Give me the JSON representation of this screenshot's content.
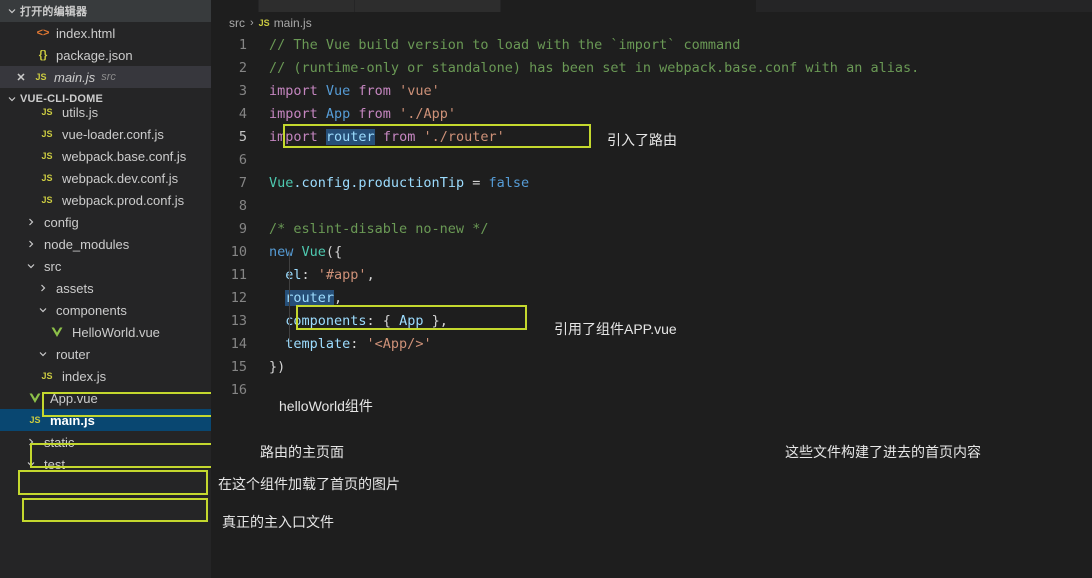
{
  "sidebar": {
    "open_editors_header": "打开的编辑器",
    "project_header": "VUE-CLI-DOME",
    "open_editors": [
      {
        "label": "index.html",
        "icon": "html-icon",
        "suffix": "",
        "closable": false
      },
      {
        "label": "package.json",
        "icon": "json-icon",
        "suffix": "",
        "closable": false
      },
      {
        "label": "main.js",
        "icon": "js-icon",
        "suffix": "src",
        "closable": true
      }
    ],
    "tree": [
      {
        "label": "utils.js",
        "icon": "js-icon",
        "indent": 2,
        "kind": "file",
        "clipped": true
      },
      {
        "label": "vue-loader.conf.js",
        "icon": "js-icon",
        "indent": 2,
        "kind": "file"
      },
      {
        "label": "webpack.base.conf.js",
        "icon": "js-icon",
        "indent": 2,
        "kind": "file"
      },
      {
        "label": "webpack.dev.conf.js",
        "icon": "js-icon",
        "indent": 2,
        "kind": "file"
      },
      {
        "label": "webpack.prod.conf.js",
        "icon": "js-icon",
        "indent": 2,
        "kind": "file"
      },
      {
        "label": "config",
        "icon": "chevron-right-icon",
        "indent": 1,
        "kind": "folder-collapsed"
      },
      {
        "label": "node_modules",
        "icon": "chevron-right-icon",
        "indent": 1,
        "kind": "folder-collapsed"
      },
      {
        "label": "src",
        "icon": "chevron-down-icon",
        "indent": 1,
        "kind": "folder-expanded"
      },
      {
        "label": "assets",
        "icon": "chevron-right-icon",
        "indent": 2,
        "kind": "folder-collapsed"
      },
      {
        "label": "components",
        "icon": "chevron-down-icon",
        "indent": 2,
        "kind": "folder-expanded"
      },
      {
        "label": "HelloWorld.vue",
        "icon": "vue-icon",
        "indent": 3,
        "kind": "file",
        "highlighted": true
      },
      {
        "label": "router",
        "icon": "chevron-down-icon",
        "indent": 2,
        "kind": "folder-expanded"
      },
      {
        "label": "index.js",
        "icon": "js-icon",
        "indent": 3,
        "kind": "file",
        "highlighted": true
      },
      {
        "label": "App.vue",
        "icon": "vue-icon",
        "indent": 2,
        "kind": "file",
        "highlighted": true
      },
      {
        "label": "main.js",
        "icon": "js-icon",
        "indent": 2,
        "kind": "file",
        "highlighted": true,
        "selected": true
      },
      {
        "label": "static",
        "icon": "chevron-right-icon",
        "indent": 1,
        "kind": "folder-collapsed"
      },
      {
        "label": "test",
        "icon": "chevron-down-icon",
        "indent": 1,
        "kind": "folder-expanded"
      }
    ]
  },
  "editor": {
    "breadcrumb": {
      "folder": "src",
      "separator": "›",
      "file": "main.js",
      "file_icon": "js-icon"
    },
    "lines": [
      {
        "n": "1",
        "tokens": [
          {
            "t": "// The Vue build version to load with the `import` command",
            "c": "t-comment"
          }
        ]
      },
      {
        "n": "2",
        "tokens": [
          {
            "t": "// (runtime-only or standalone) has been set in webpack.base.conf with an alias.",
            "c": "t-comment"
          }
        ]
      },
      {
        "n": "3",
        "tokens": [
          {
            "t": "import ",
            "c": "t-kw"
          },
          {
            "t": "Vue",
            "c": "t-const"
          },
          {
            "t": " from ",
            "c": "t-kw"
          },
          {
            "t": "'vue'",
            "c": "t-str"
          }
        ]
      },
      {
        "n": "4",
        "tokens": [
          {
            "t": "import ",
            "c": "t-kw"
          },
          {
            "t": "App",
            "c": "t-const"
          },
          {
            "t": " from ",
            "c": "t-kw"
          },
          {
            "t": "'./App'",
            "c": "t-str"
          }
        ]
      },
      {
        "n": "5",
        "current": true,
        "tokens": [
          {
            "t": "import ",
            "c": "t-kw"
          },
          {
            "t": "router",
            "c": "t-var sel"
          },
          {
            "t": " from ",
            "c": "t-kw"
          },
          {
            "t": "'./router'",
            "c": "t-str"
          }
        ]
      },
      {
        "n": "6",
        "tokens": []
      },
      {
        "n": "7",
        "tokens": [
          {
            "t": "Vue",
            "c": "t-class"
          },
          {
            "t": ".config.productionTip",
            "c": "t-var"
          },
          {
            "t": " = ",
            "c": "t-punc"
          },
          {
            "t": "false",
            "c": "t-const"
          }
        ]
      },
      {
        "n": "8",
        "tokens": []
      },
      {
        "n": "9",
        "tokens": [
          {
            "t": "/* eslint-disable no-new */",
            "c": "t-comment"
          }
        ]
      },
      {
        "n": "10",
        "tokens": [
          {
            "t": "new ",
            "c": "t-const"
          },
          {
            "t": "Vue",
            "c": "t-class"
          },
          {
            "t": "({",
            "c": "t-punc"
          }
        ]
      },
      {
        "n": "11",
        "tokens": [
          {
            "t": "  el",
            "c": "t-prop"
          },
          {
            "t": ": ",
            "c": "t-punc"
          },
          {
            "t": "'#app'",
            "c": "t-str"
          },
          {
            "t": ",",
            "c": "t-punc"
          }
        ]
      },
      {
        "n": "12",
        "tokens": [
          {
            "t": "  ",
            "c": "t-punc"
          },
          {
            "t": "router",
            "c": "t-prop sel"
          },
          {
            "t": ",",
            "c": "t-punc"
          }
        ]
      },
      {
        "n": "13",
        "tokens": [
          {
            "t": "  components",
            "c": "t-prop"
          },
          {
            "t": ": { ",
            "c": "t-punc"
          },
          {
            "t": "App",
            "c": "t-var"
          },
          {
            "t": " },",
            "c": "t-punc"
          }
        ]
      },
      {
        "n": "14",
        "tokens": [
          {
            "t": "  template",
            "c": "t-prop"
          },
          {
            "t": ": ",
            "c": "t-punc"
          },
          {
            "t": "'<App/>'",
            "c": "t-str"
          }
        ]
      },
      {
        "n": "15",
        "tokens": [
          {
            "t": "})",
            "c": "t-punc"
          }
        ]
      },
      {
        "n": "16",
        "tokens": []
      }
    ]
  },
  "annotations": {
    "router_import": "引入了路由",
    "components_app": "引用了组件APP.vue",
    "hello_world": "helloWorld组件",
    "router_home": "路由的主页面",
    "app_vue": "在这个组件加载了首页的图片",
    "main_js": "真正的主入口文件",
    "files_build_home": "这些文件构建了进去的首页内容"
  },
  "colors": {
    "highlight_box": "#c4d82e",
    "selection_blue": "#094771",
    "editor_bg": "#1e1e1e",
    "sidebar_bg": "#252526"
  }
}
